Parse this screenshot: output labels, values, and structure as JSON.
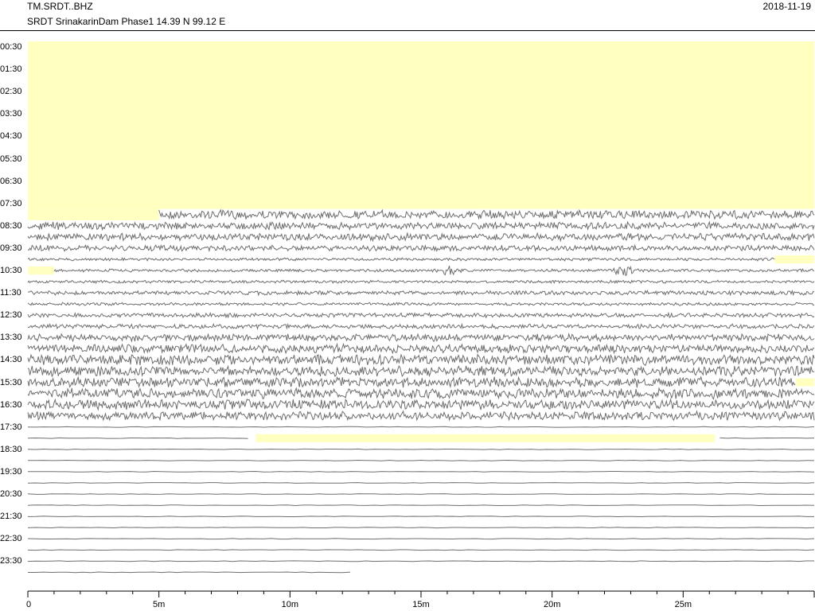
{
  "header": {
    "title": "TM.SRDT..BHZ",
    "subtitle": "SRDT SrinakarinDam Phase1  14.39 N 99.12 E",
    "date": "2018-11-19"
  },
  "chart_data": {
    "type": "helicorder",
    "row_labels": [
      "00:30",
      "01:30",
      "02:30",
      "03:30",
      "04:30",
      "05:30",
      "06:30",
      "07:30",
      "08:30",
      "09:30",
      "10:30",
      "11:30",
      "12:30",
      "13:30",
      "14:30",
      "15:30",
      "16:30",
      "17:30",
      "18:30",
      "19:30",
      "20:30",
      "21:30",
      "22:30",
      "23:30"
    ],
    "traces_per_hour": 2,
    "x_range_min": [
      0,
      30
    ],
    "x_tick_labels": [
      {
        "value": 0,
        "label": "0"
      },
      {
        "value": 5,
        "label": "5m"
      },
      {
        "value": 10,
        "label": "10m"
      },
      {
        "value": 15,
        "label": "15m"
      },
      {
        "value": 20,
        "label": "20m"
      },
      {
        "value": 25,
        "label": "25m"
      }
    ],
    "data_start_min_from_first_trace": 455,
    "data_end": {
      "trace": 47,
      "minute": 12.5
    },
    "gap_color": "#ffffc0",
    "trace_color": "#6e6e6e",
    "noise_amplitude_by_trace": {
      "15": 6,
      "16": 5,
      "17": 5,
      "18": 4,
      "19": 2,
      "20": 2,
      "21": 2,
      "22": 3,
      "23": 2,
      "24": 3,
      "25": 3,
      "26": 5,
      "27": 6,
      "28": 7,
      "29": 7,
      "30": 7,
      "31": 7,
      "32": 7,
      "33": 6,
      "34": 1,
      "35": 1
    },
    "gaps": [
      {
        "trace": 35,
        "start_min": 8.7,
        "end_min": 26.2
      },
      {
        "trace": 30,
        "start_min": 29.3,
        "end_min": 30
      },
      {
        "trace": 19,
        "start_min": 28.5,
        "end_min": 30
      },
      {
        "trace": 20,
        "start_min": 0,
        "end_min": 1.0
      }
    ],
    "events": [
      {
        "trace": 20,
        "minute": 16.0,
        "amplitude": 8
      },
      {
        "trace": 20,
        "minute": 22.8,
        "amplitude": 10
      },
      {
        "trace": 22,
        "minute": 8.3,
        "amplitude": 5
      },
      {
        "trace": 27,
        "minute": 17.4,
        "amplitude": 8
      },
      {
        "trace": 28,
        "minute": 23.5,
        "amplitude": 8
      }
    ]
  }
}
